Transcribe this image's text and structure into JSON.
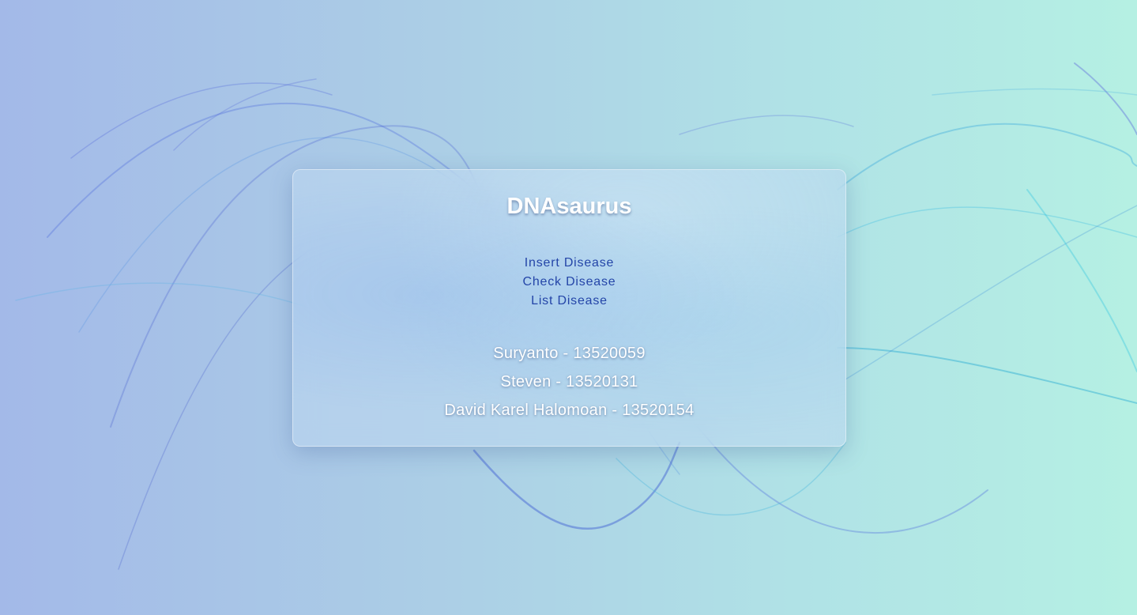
{
  "app": {
    "title": "DNAsaurus"
  },
  "nav": {
    "items": [
      {
        "label": "Insert Disease"
      },
      {
        "label": "Check Disease"
      },
      {
        "label": "List Disease"
      }
    ]
  },
  "team": {
    "members": [
      {
        "text": "Suryanto - 13520059"
      },
      {
        "text": "Steven - 13520131"
      },
      {
        "text": "David Karel Halomoan - 13520154"
      }
    ]
  },
  "colors": {
    "link": "#2445a8",
    "title": "#ffffff",
    "background_start": "#a3b9e8",
    "background_end": "#b5f0e3"
  }
}
